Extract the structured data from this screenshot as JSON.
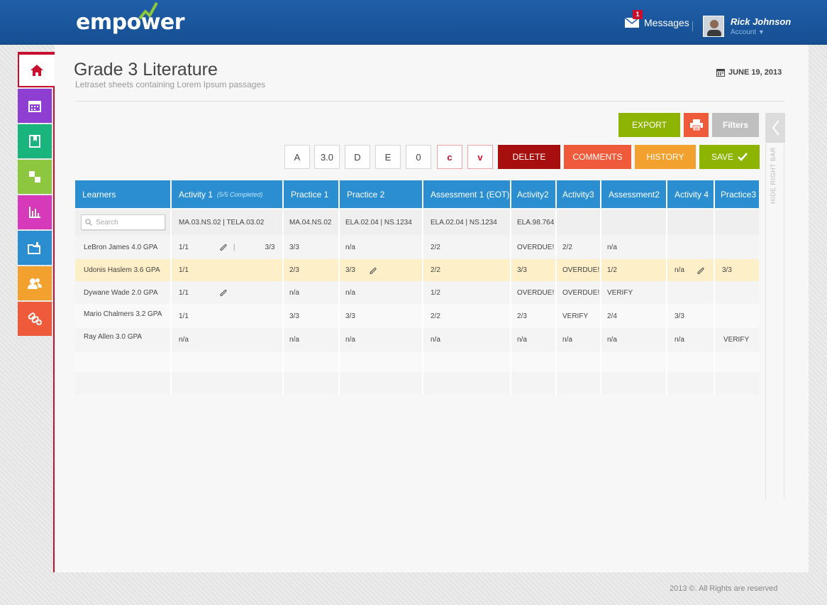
{
  "header": {
    "logo": "empower",
    "messages_label": "Messages",
    "messages_count": "1",
    "user_name": "Rick Johnson",
    "account_label": "Account",
    "colors": {
      "bar": "#1f5ea8",
      "logo_accent": "#8dc63f"
    }
  },
  "sidebar": {
    "items": [
      {
        "icon": "home-icon",
        "color": "#ffffff"
      },
      {
        "icon": "calendar-icon",
        "color": "#8e3fd1"
      },
      {
        "icon": "book-icon",
        "color": "#1ab47d"
      },
      {
        "icon": "grid-icon",
        "color": "#8dc63f"
      },
      {
        "icon": "bar-chart-icon",
        "color": "#d63aba"
      },
      {
        "icon": "folder-download-icon",
        "color": "#2b8ed0"
      },
      {
        "icon": "users-icon",
        "color": "#f2a12e"
      },
      {
        "icon": "link-add-icon",
        "color": "#ef5a3b"
      }
    ]
  },
  "page": {
    "title": "Grade 3 Literature",
    "subtitle": "Letraset sheets containing Lorem Ipsum passages",
    "date": "JUNE 19, 2013"
  },
  "toolbar": {
    "export_label": "EXPORT",
    "filters_label": "Filters",
    "grade_buttons": [
      "A",
      "3.0",
      "D",
      "E",
      "0",
      "c",
      "v"
    ],
    "delete_label": "DELETE",
    "comments_label": "COMMENTS",
    "history_label": "HISTORY",
    "save_label": "SAVE",
    "hide_bar_label": "HIDE RIGHT BAR",
    "colors": {
      "export": "#8cb400",
      "print": "#ef5a3b",
      "filters": "#bfbfbf",
      "delete": "#a70f0f",
      "comments": "#ef5a3b",
      "history": "#f2a12e",
      "save": "#8cb400"
    }
  },
  "grid": {
    "columns": [
      {
        "label": "Learners"
      },
      {
        "label": "Activity 1",
        "sub": "(5/5 Completed)"
      },
      {
        "label": "Practice 1"
      },
      {
        "label": "Practice 2"
      },
      {
        "label": "Assessment 1 (EOT)"
      },
      {
        "label": "Activity2"
      },
      {
        "label": "Activity3"
      },
      {
        "label": "Assessment2"
      },
      {
        "label": "Activity 4"
      },
      {
        "label": "Practice3"
      }
    ],
    "search_placeholder": "Search",
    "codes": [
      "",
      "MA.03.NS.02   |   TELA.03.02",
      "MA.04.NS.02",
      "ELA.02.04  |  NS.1234",
      "ELA.02.04  |  NS.1234",
      "ELA.98.764",
      "",
      "",
      "",
      ""
    ],
    "rows": [
      {
        "name": "LeBron James 4.0 GPA",
        "cells": [
          "1/1",
          "3/3",
          "n/a",
          "2/2",
          "OVERDUE!",
          "2/2",
          "n/a",
          "",
          ""
        ]
      },
      {
        "name": "Udonis Haslem 3.6 GPA",
        "cells": [
          "1/1",
          "2/3",
          "3/3",
          "2/2",
          "3/3",
          "OVERDUE!",
          "1/2",
          "n/a",
          "3/3"
        ],
        "highlight": true
      },
      {
        "name": "Dywane Wade 2.0 GPA",
        "cells": [
          "1/1",
          "n/a",
          "n/a",
          "1/2",
          "OVERDUE!",
          "OVERDUE!",
          "VERIFY",
          "",
          ""
        ]
      },
      {
        "name": "Mario Chalmers 3.2 GPA",
        "cells": [
          "1/1",
          "3/3",
          "3/3",
          "2/2",
          "2/3",
          "VERIFY",
          "2/4",
          "3/3",
          ""
        ]
      },
      {
        "name": "Ray Allen 3.0 GPA",
        "cells": [
          "n/a",
          "n/a",
          "n/a",
          "n/a",
          "n/a",
          "n/a",
          "n/a",
          "n/a",
          "VERIFY"
        ]
      }
    ],
    "lebron_extra": "3/3"
  },
  "footer": {
    "copyright": "2013 ©. All Rights are reserved"
  }
}
